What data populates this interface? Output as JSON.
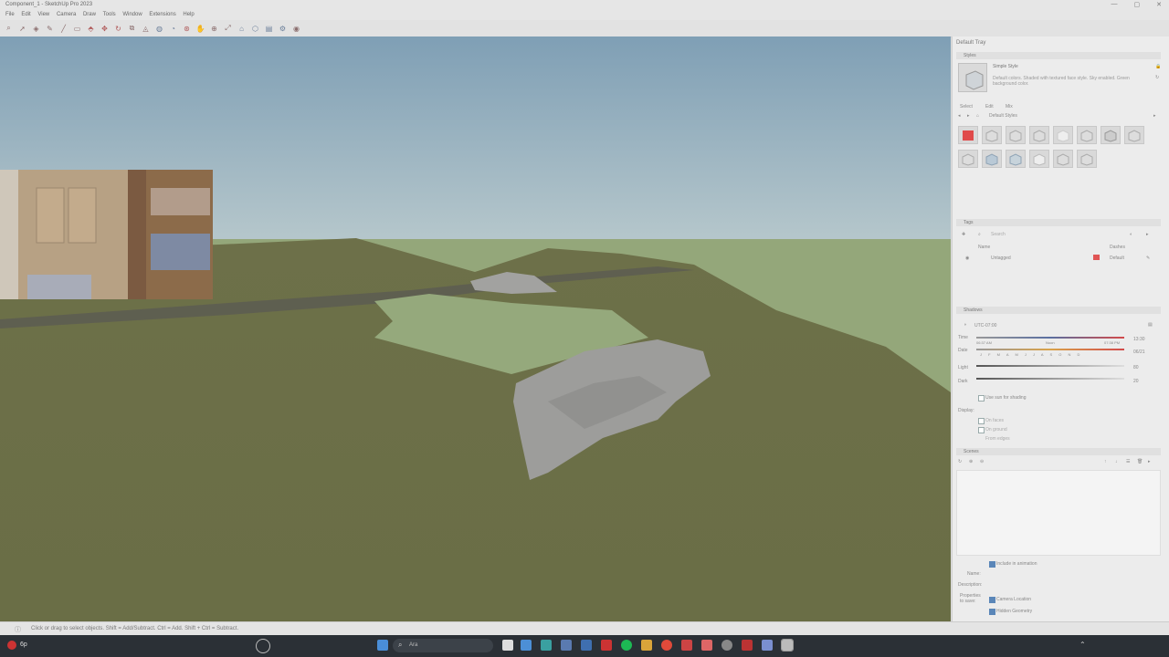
{
  "window": {
    "title": "Component_1 - SketchUp Pro 2023",
    "controls": [
      "—",
      "▢",
      "✕"
    ]
  },
  "menu": [
    "File",
    "Edit",
    "View",
    "Camera",
    "Draw",
    "Tools",
    "Window",
    "Extensions",
    "Help"
  ],
  "tray": {
    "title": "Default Tray",
    "styles": {
      "header": "Styles",
      "style_name": "Simple Style",
      "style_desc": "Default colors. Shaded with textured face style. Sky enabled. Green background color.",
      "tabs": [
        "Select",
        "Edit",
        "Mix"
      ],
      "collection": "Default Styles"
    },
    "tags": {
      "header": "Tags",
      "search_placeholder": "Search",
      "col_name": "Name",
      "col_dashes": "Dashes",
      "row_name": "Untagged",
      "row_dashes": "Default",
      "row_color": "#e05555"
    },
    "shadows": {
      "header": "Shadows",
      "utc": "UTC-07:00",
      "time_label": "Time",
      "time_start": "06:37 AM",
      "time_mid": "Noon",
      "time_end": "07:38 PM",
      "time_value": "13:30",
      "date_label": "Date",
      "months": "J F M A M J J A S O N D",
      "date_value": "06/21",
      "light_label": "Light",
      "light_value": "80",
      "dark_label": "Dark",
      "dark_value": "20",
      "use_sun": "Use sun for shading",
      "display_label": "Display:",
      "on_faces": "On faces",
      "on_ground": "On ground",
      "from_edges": "From edges"
    },
    "scenes": {
      "header": "Scenes",
      "include_anim": "Include in animation",
      "name_label": "Name:",
      "desc_label": "Description:",
      "props_label": "Properties to save:",
      "camera_loc": "Camera Location",
      "hidden_geo": "Hidden Geometry"
    }
  },
  "status": {
    "hint": "Click or drag to select objects. Shift = Add/Subtract. Ctrl = Add. Shift + Ctrl = Subtract."
  },
  "taskbar": {
    "search_placeholder": "Ara",
    "temp": "6p",
    "colors": {
      "bg": "#2b3036"
    }
  },
  "colors": {
    "sky_top": "#7f9fb5",
    "sky_bottom": "#b7c8cc",
    "ground": "#94a77a",
    "terrain": "#6a6e46"
  }
}
